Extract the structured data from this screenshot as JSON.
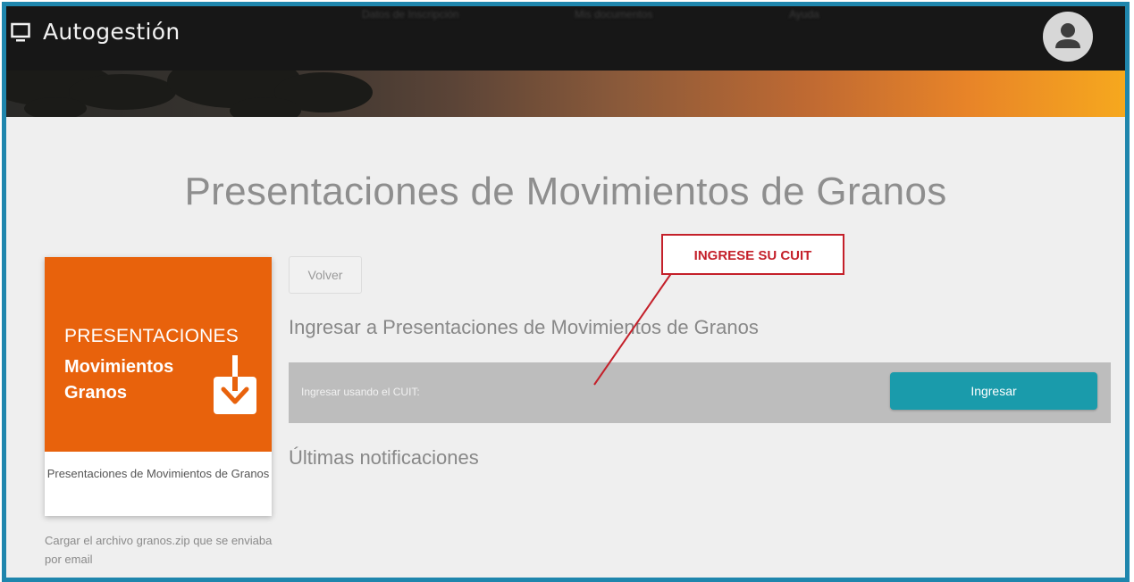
{
  "header": {
    "brand": "Autogestión",
    "nav": [
      "Datos de Inscripción",
      "Mis documentos",
      "Ayuda"
    ]
  },
  "page": {
    "title": "Presentaciones de Movimientos de Granos"
  },
  "sidebar_card": {
    "image_line1": "PRESENTACIONES",
    "image_line2": "Movimientos",
    "image_line3": "Granos",
    "caption": "Presentaciones de Movimientos de Granos",
    "description": "Cargar el archivo granos.zip que se enviaba por email"
  },
  "main": {
    "back_button": "Volver",
    "section_title": "Ingresar a Presentaciones de Movimientos de Granos",
    "cuit_label": "Ingresar usando el CUIT:",
    "login_button": "Ingresar",
    "notifications_title": "Últimas notificaciones"
  },
  "annotation": {
    "callout_text": "INGRESE SU CUIT"
  },
  "colors": {
    "frame": "#1f86ad",
    "card_orange": "#e8620c",
    "button_teal": "#1a9bab",
    "callout_red": "#c4202a",
    "bar_gray": "#bdbdbd"
  }
}
